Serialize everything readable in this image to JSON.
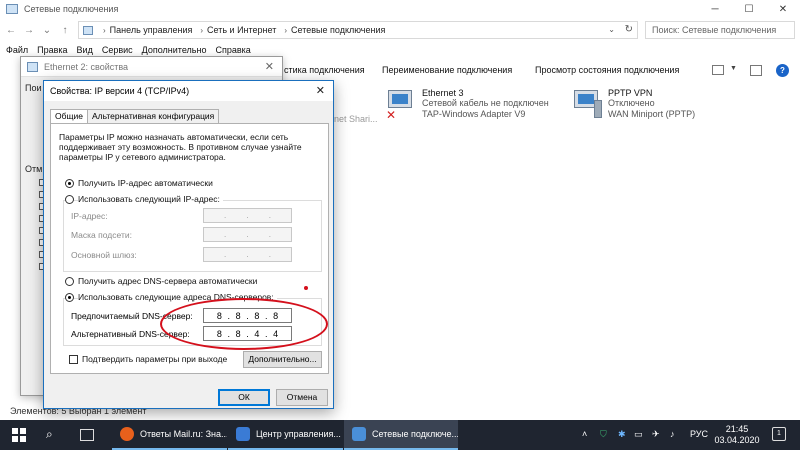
{
  "explorer": {
    "title": "Сетевые подключения",
    "breadcrumb": [
      "Панель управления",
      "Сеть и Интернет",
      "Сетевые подключения"
    ],
    "search_placeholder": "Поиск: Сетевые подключения",
    "menu": [
      "Файл",
      "Правка",
      "Вид",
      "Сервис",
      "Дополнительно",
      "Справка"
    ],
    "commands": {
      "diagnostics": "стика подключения",
      "rename": "Переименование подключения",
      "status": "Просмотр состояния подключения"
    },
    "connections": [
      {
        "name": "Ethernet 3",
        "status": "Сетевой кабель не подключен",
        "device": "TAP-Windows Adapter V9"
      },
      {
        "name": "PPTP VPN",
        "status": "Отключено",
        "device": "WAN Miniport (PPTP)"
      }
    ],
    "ghost_label": "net Shari...",
    "status_bar": "Элементов: 5    Выбран 1 элемент"
  },
  "eth2": {
    "title": "Ethernet 2: свойства",
    "frag1": "Пои",
    "frag2": "Отм"
  },
  "ipv4": {
    "title": "Свойства: IP версии 4 (TCP/IPv4)",
    "tabs": [
      "Общие",
      "Альтернативная конфигурация"
    ],
    "description": "Параметры IP можно назначать автоматически, если сеть поддерживает эту возможность. В противном случае узнайте параметры IP у сетевого администратора.",
    "ip_auto": "Получить IP-адрес автоматически",
    "ip_manual": "Использовать следующий IP-адрес:",
    "ip_address_label": "IP-адрес:",
    "mask_label": "Маска подсети:",
    "gateway_label": "Основной шлюз:",
    "dns_auto": "Получить адрес DNS-сервера автоматически",
    "dns_manual": "Использовать следующие адреса DNS-серверов:",
    "preferred_dns_label": "Предпочитаемый DNS-сервер:",
    "alternate_dns_label": "Альтернативный DNS-сервер:",
    "preferred_dns": [
      "8",
      "8",
      "8",
      "8"
    ],
    "alternate_dns": [
      "8",
      "8",
      "4",
      "4"
    ],
    "validate_label": "Подтвердить параметры при выходе",
    "advanced_button": "Дополнительно...",
    "ok_button": "ОК",
    "cancel_button": "Отмена"
  },
  "taskbar": {
    "items": [
      {
        "label": "Ответы Mail.ru: Зна...",
        "color": "#e8601c"
      },
      {
        "label": "Центр управления...",
        "color": "#3a7bd5"
      },
      {
        "label": "Сетевые подключе...",
        "color": "#4a8fd8"
      }
    ],
    "language": "РУС",
    "time": "21:45",
    "date": "03.04.2020",
    "notifications": "1"
  }
}
